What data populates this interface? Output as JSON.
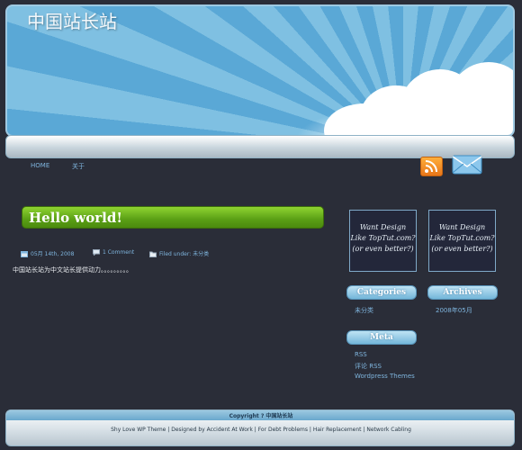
{
  "site": {
    "title": "中国站长站"
  },
  "nav": {
    "home": "HOME",
    "about": "关于"
  },
  "icons": {
    "rss": "rss-feed-icon",
    "mail": "mail-icon"
  },
  "post": {
    "title": "Hello world!",
    "date": "05月 14th, 2008",
    "comments": "1 Comment",
    "filed_label": "Filed under:",
    "category": "未分类",
    "body": "中国站长站为中文站长提供动力。。。。。。。。。"
  },
  "ads": [
    {
      "line1": "Want Design",
      "line2": "Like TopTut.com?",
      "line3": "(or even better?)"
    },
    {
      "line1": "Want Design",
      "line2": "Like TopTut.com?",
      "line3": "(or even better?)"
    }
  ],
  "widgets": {
    "categories": {
      "title": "Categories",
      "items": [
        "未分类"
      ]
    },
    "archives": {
      "title": "Archives",
      "items": [
        "2008年05月"
      ]
    },
    "meta": {
      "title": "Meta",
      "items": [
        "RSS",
        "评论 RSS",
        "Wordpress Themes"
      ]
    }
  },
  "footer": {
    "copyright": "Copyright ? 中国站长站",
    "credits": "Shy Love WP Theme | Designed by Accident At Work | For Debt Problems | Hair Replacement | Network Cabling"
  },
  "colors": {
    "background": "#2a2d38",
    "link": "#7fb5de",
    "title_bar": "#5a9f15",
    "widget_head": "#74b6d9"
  }
}
